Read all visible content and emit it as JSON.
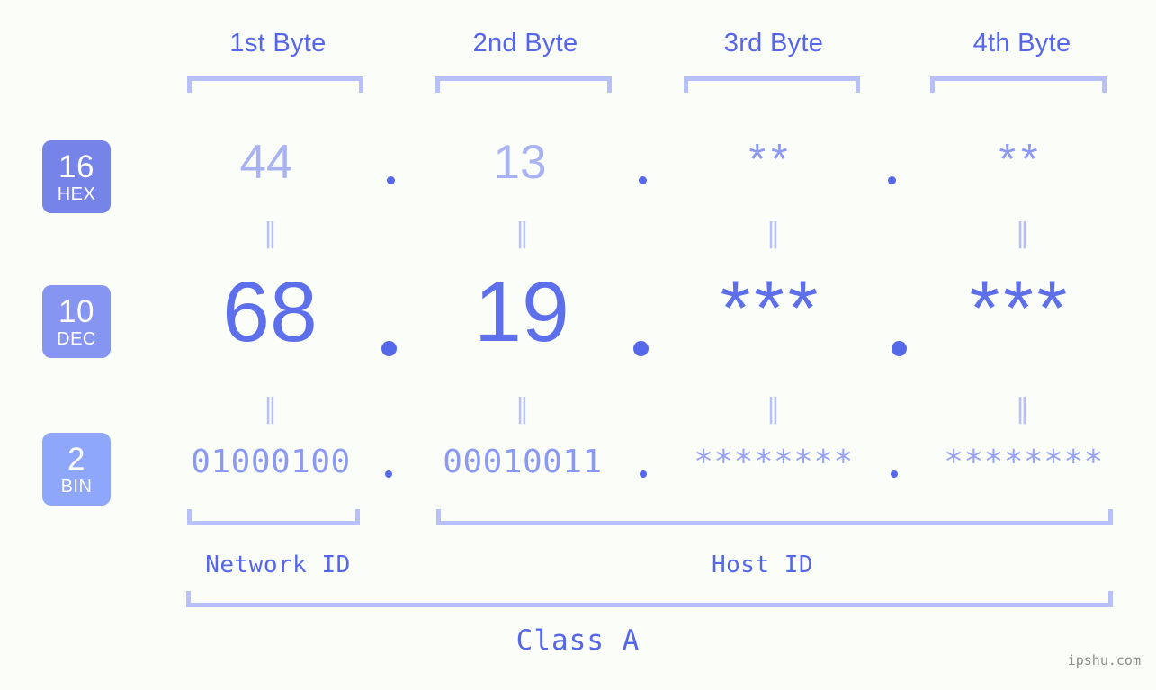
{
  "background_color": "#fbfdf8",
  "accent_color": "#5566ea",
  "bracket_color": "#b7c0f8",
  "headers": [
    {
      "label": "1st Byte"
    },
    {
      "label": "2nd Byte"
    },
    {
      "label": "3rd Byte"
    },
    {
      "label": "4th Byte"
    }
  ],
  "bases": [
    {
      "number": "16",
      "abbr": "HEX",
      "color": "#7683e8"
    },
    {
      "number": "10",
      "abbr": "DEC",
      "color": "#8694f2"
    },
    {
      "number": "2",
      "abbr": "BIN",
      "color": "#8fa7fb"
    }
  ],
  "rows": {
    "hex": {
      "values": [
        "44",
        "13",
        "**",
        "**"
      ]
    },
    "dec": {
      "values": [
        "68",
        "19",
        "***",
        "***"
      ]
    },
    "bin": {
      "values": [
        "01000100",
        "00010011",
        "********",
        "********"
      ]
    }
  },
  "separators": {
    "dot": ".",
    "equals": "‖"
  },
  "segments": {
    "network_id": "Network ID",
    "host_id": "Host ID"
  },
  "class_label": "Class A",
  "watermark": "ipshu.com"
}
